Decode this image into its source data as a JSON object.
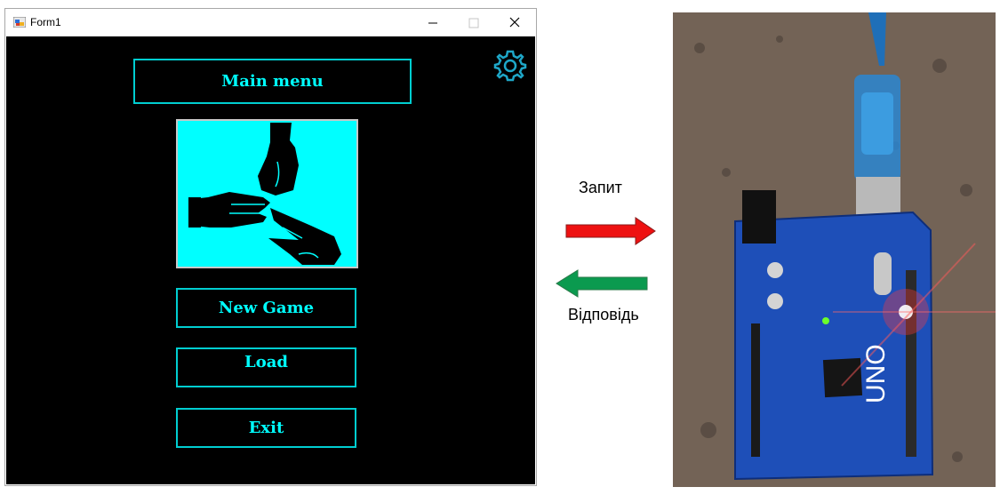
{
  "window": {
    "title": "Form1",
    "icon": "winforms-app-icon",
    "controls": {
      "minimize": "minimize-icon",
      "maximize": "maximize-icon",
      "close": "close-icon"
    }
  },
  "menu": {
    "title": "Main menu",
    "new_game": "New Game",
    "load": "Load",
    "exit": "Exit",
    "settings_icon": "gear-icon",
    "image": "rock-paper-scissors-hands"
  },
  "diagram": {
    "request": "Запит",
    "response": "Відповідь",
    "request_arrow_color": "#ee1111",
    "response_arrow_color": "#0b9a4f"
  },
  "colors": {
    "accent": "#00ffff",
    "background": "#000000"
  },
  "board": {
    "label": "UNO"
  }
}
